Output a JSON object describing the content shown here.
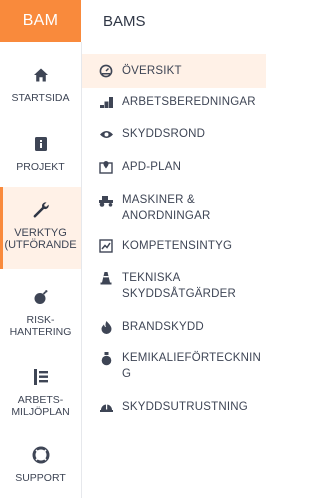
{
  "rail": {
    "brand": "BAM",
    "items": [
      {
        "label": "STARTSIDA"
      },
      {
        "label": "PROJEKT"
      },
      {
        "label": "VERKTYG (UTFÖRANDE"
      },
      {
        "label": "RISK-HANTERING"
      },
      {
        "label": "ARBETS-MILJÖPLAN"
      },
      {
        "label": "SUPPORT"
      }
    ]
  },
  "header": {
    "title": "BAMS"
  },
  "menu": {
    "items": [
      {
        "label": "ÖVERSIKT"
      },
      {
        "label": "ARBETSBEREDNINGAR"
      },
      {
        "label": "SKYDDSROND"
      },
      {
        "label": "APD-PLAN"
      },
      {
        "label": "MASKINER & ANORDNINGAR"
      },
      {
        "label": "KOMPETENSINTYG"
      },
      {
        "label": "TEKNISKA SKYDDSÅTGÄRDER"
      },
      {
        "label": "BRANDSKYDD"
      },
      {
        "label": "KEMIKALIEFÖRTECKNING"
      },
      {
        "label": "SKYDDSUTRUSTNING"
      }
    ]
  },
  "colors": {
    "accent": "#f98a3c",
    "active_bg": "#fff1e7",
    "text": "#3e4555"
  }
}
